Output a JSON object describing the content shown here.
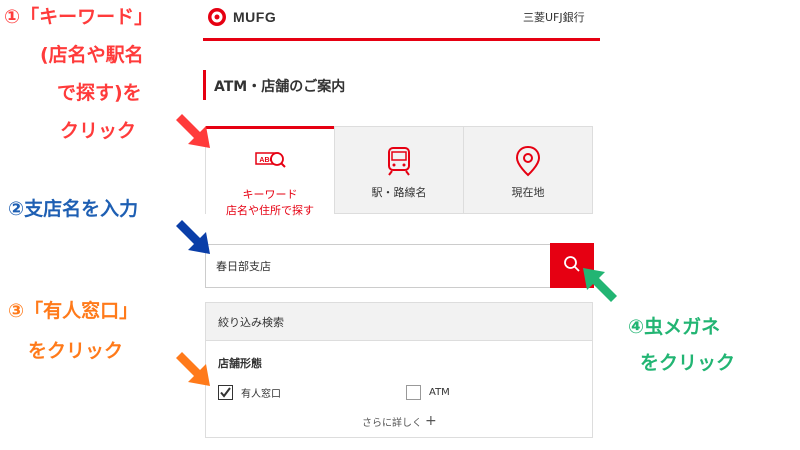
{
  "header": {
    "logo_text": "MUFG",
    "bank_name": "三菱UFJ銀行"
  },
  "page_title": "ATM・店舗のご案内",
  "tabs": [
    {
      "label_line1": "キーワード",
      "label_line2": "店名や住所で探す",
      "icon": "keyword-search-icon",
      "active": true
    },
    {
      "label_line1": "駅・路線名",
      "icon": "train-icon",
      "active": false
    },
    {
      "label_line1": "現在地",
      "icon": "location-pin-icon",
      "active": false
    }
  ],
  "search": {
    "value": "春日部支店",
    "button_icon": "search-icon"
  },
  "filter": {
    "header": "絞り込み検索",
    "section_label": "店舗形態",
    "options": [
      {
        "label": "有人窓口",
        "checked": true
      },
      {
        "label": "ATM",
        "checked": false
      }
    ],
    "more_label": "さらに詳しく"
  },
  "annotations": {
    "step1": [
      "①「キーワード」",
      "(店名や駅名",
      "で探す)を",
      "クリック"
    ],
    "step2": "②支店名を入力",
    "step3": [
      "③「有人窓口」",
      "をクリック"
    ],
    "step4": [
      "④虫メガネ",
      "をクリック"
    ]
  },
  "colors": {
    "brand_red": "#e60012",
    "step1": "#ff3b3b",
    "step2": "#1e5fb3",
    "step3": "#ff7a1a",
    "step4": "#22b573"
  }
}
